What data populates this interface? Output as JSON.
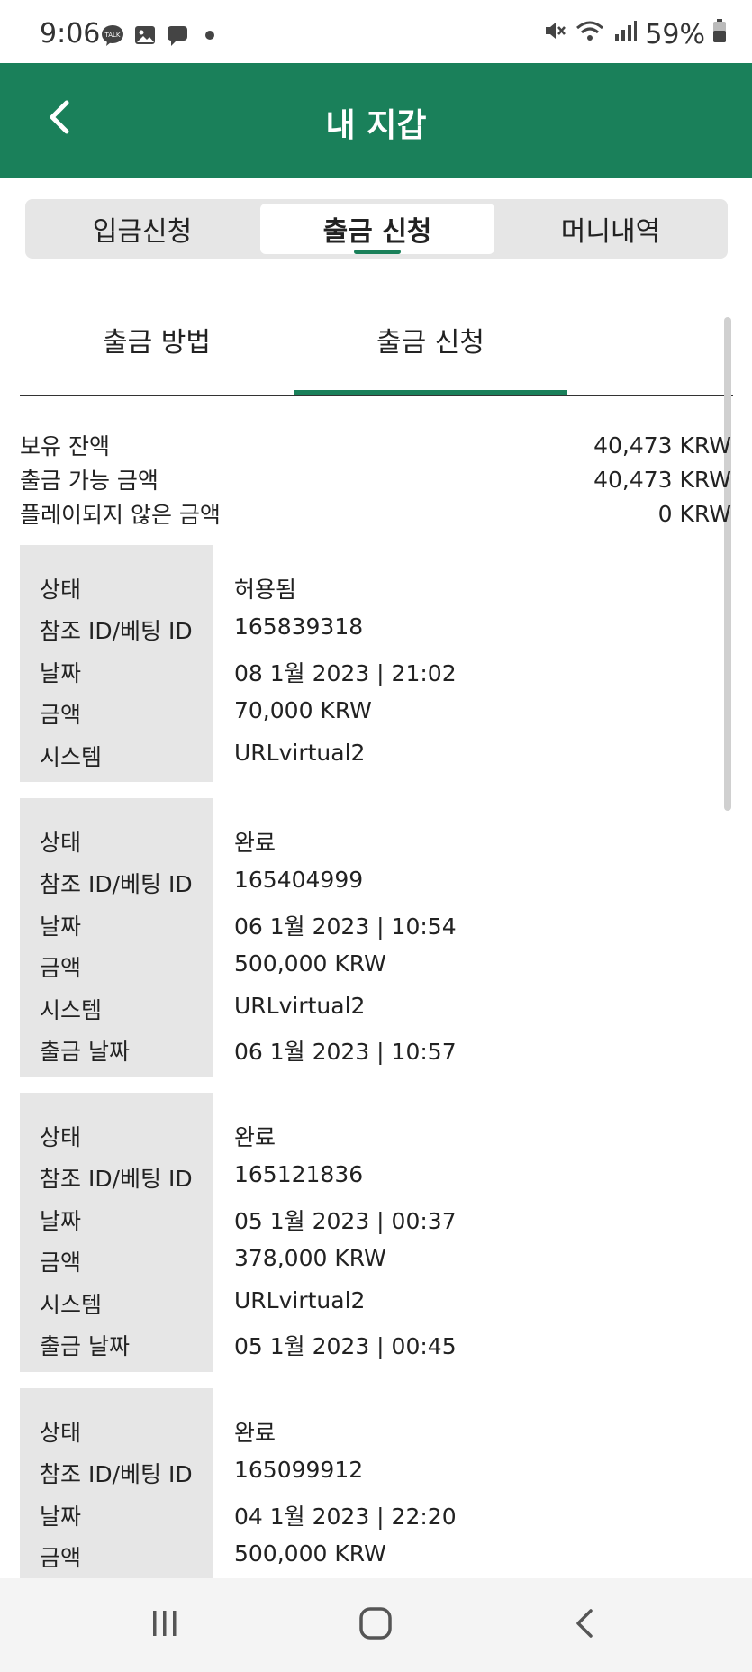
{
  "status_bar": {
    "time": "9:06",
    "battery": "59%",
    "icons_left": [
      "talk-icon",
      "gallery-icon",
      "message-icon",
      "dot-icon"
    ],
    "icons_right": [
      "mute-icon",
      "wifi-icon",
      "signal-icon",
      "battery-icon"
    ]
  },
  "header": {
    "title": "내 지갑",
    "back_icon": "chevron-left-icon",
    "background_color": "#1a805a"
  },
  "segmented_tabs": [
    {
      "label": "입금신청",
      "active": false
    },
    {
      "label": "출금 신청",
      "active": true
    },
    {
      "label": "머니내역",
      "active": false
    }
  ],
  "sub_tabs": [
    {
      "label": "출금 방법",
      "active": false
    },
    {
      "label": "출금 신청",
      "active": true
    }
  ],
  "summary": [
    {
      "label": "보유 잔액",
      "value": "40,473 KRW"
    },
    {
      "label": "출금 가능 금액",
      "value": "40,473 KRW"
    },
    {
      "label": "플레이되지 않은 금액",
      "value": "0 KRW"
    }
  ],
  "records": [
    {
      "rows": [
        {
          "label": "상태",
          "value": "허용됨"
        },
        {
          "label": "참조 ID/베팅 ID",
          "value": "165839318"
        },
        {
          "label": "날짜",
          "value": "08 1월 2023 | 21:02"
        },
        {
          "label": "금액",
          "value": "70,000 KRW"
        },
        {
          "label": "시스템",
          "value": "URLvirtual2"
        }
      ]
    },
    {
      "rows": [
        {
          "label": "상태",
          "value": "완료"
        },
        {
          "label": "참조 ID/베팅 ID",
          "value": "165404999"
        },
        {
          "label": "날짜",
          "value": "06 1월 2023 | 10:54"
        },
        {
          "label": "금액",
          "value": "500,000 KRW"
        },
        {
          "label": "시스템",
          "value": "URLvirtual2"
        },
        {
          "label": "출금 날짜",
          "value": "06 1월 2023 | 10:57"
        }
      ]
    },
    {
      "rows": [
        {
          "label": "상태",
          "value": "완료"
        },
        {
          "label": "참조 ID/베팅 ID",
          "value": "165121836"
        },
        {
          "label": "날짜",
          "value": "05 1월 2023 | 00:37"
        },
        {
          "label": "금액",
          "value": "378,000 KRW"
        },
        {
          "label": "시스템",
          "value": "URLvirtual2"
        },
        {
          "label": "출금 날짜",
          "value": "05 1월 2023 | 00:45"
        }
      ]
    },
    {
      "rows": [
        {
          "label": "상태",
          "value": "완료"
        },
        {
          "label": "참조 ID/베팅 ID",
          "value": "165099912"
        },
        {
          "label": "날짜",
          "value": "04 1월 2023 | 22:20"
        },
        {
          "label": "금액",
          "value": "500,000 KRW"
        }
      ]
    }
  ],
  "nav_bar": {
    "icons": [
      "recent-apps-icon",
      "home-icon",
      "back-icon"
    ]
  }
}
